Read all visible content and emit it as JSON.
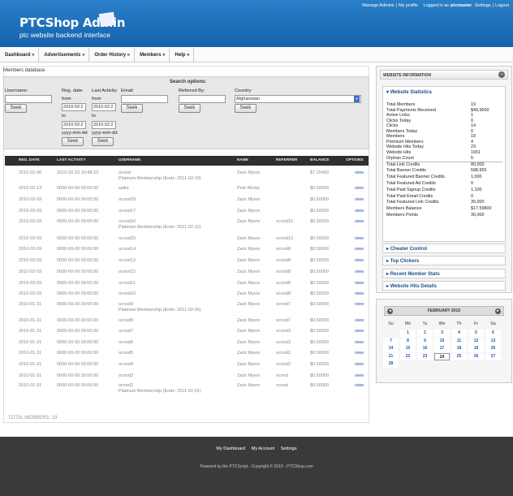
{
  "header": {
    "title": "PTCShop Admin",
    "subtitle": "ptc website backend interface",
    "links": [
      "Manage Admins",
      "|",
      "My profile",
      "Logged in as",
      "ptcmaster",
      "Settings",
      "|",
      "Logout"
    ]
  },
  "nav": [
    "Dashboard »",
    "Advertisements »",
    "Order History »",
    "Members »",
    "Help »"
  ],
  "page_title": "Members database",
  "search": {
    "title": "Search options:",
    "username_label": "Username:",
    "reg_label": "Reg. date:",
    "activity_label": "Last Activity:",
    "email_label": "Email:",
    "ref_label": "Referred By:",
    "country_label": "Country:",
    "from": "from",
    "to": "to",
    "date1": "2010:02:2",
    "date2": "2010:02:2",
    "fmt": "yyyy-mm-dd",
    "country_value": "Afghanistan",
    "seek": "Seek"
  },
  "table": {
    "headers": [
      "REG. DATE",
      "LAST ACTIVITY",
      "USERNAME",
      "NAME",
      "REFERRER",
      "BALANCE",
      "OPTIONS"
    ],
    "rows": [
      {
        "reg": "2010-02-06",
        "act": "2010-02-23 10:48:23",
        "user": "ocnod",
        "sub": "Platinum Membership (Ends: 2011-02-19)",
        "name": "Zack Myers",
        "ref": "",
        "bal": "$7.25400",
        "opt": "view"
      },
      {
        "reg": "2010-02-13",
        "act": "0000-00-00 00:00:00",
        "user": "spike",
        "sub": "",
        "name": "Pete Morby",
        "ref": "",
        "bal": "$0.50000",
        "opt": "view"
      },
      {
        "reg": "2010-02-09",
        "act": "0000-00-00 00:00:00",
        "user": "ocnod18",
        "sub": "",
        "name": "Zack Myers",
        "ref": "",
        "bal": "$0.50000",
        "opt": "view"
      },
      {
        "reg": "2010-02-09",
        "act": "0000-00-00 00:00:00",
        "user": "ocnod17",
        "sub": "",
        "name": "Zack Myers",
        "ref": "",
        "bal": "$0.50000",
        "opt": "view"
      },
      {
        "reg": "2010-02-09",
        "act": "0000-00-00 00:00:00",
        "user": "ocnod16",
        "sub": "Platinum Membership (Ends: 2011-02-12)",
        "name": "Zack Myers",
        "ref": "ocnod15",
        "bal": "$0.90000",
        "opt": "view"
      },
      {
        "reg": "2010-02-09",
        "act": "0000-00-00 00:00:00",
        "user": "ocnod15",
        "sub": "",
        "name": "Zack Myers",
        "ref": "ocnod13",
        "bal": "$0.50000",
        "opt": "view"
      },
      {
        "reg": "2010-02-09",
        "act": "0000-00-00 00:00:00",
        "user": "ocnod14",
        "sub": "",
        "name": "Zack Myers",
        "ref": "ocnod8",
        "bal": "$0.50000",
        "opt": "view"
      },
      {
        "reg": "2010-02-09",
        "act": "0000-00-00 00:00:00",
        "user": "ocnod13",
        "sub": "",
        "name": "Zack Myers",
        "ref": "ocnod8",
        "bal": "$0.50000",
        "opt": "view"
      },
      {
        "reg": "2010-02-09",
        "act": "0000-00-00 00:00:00",
        "user": "ocnod12",
        "sub": "",
        "name": "Zack Myers",
        "ref": "ocnod8",
        "bal": "$0.50000",
        "opt": "view"
      },
      {
        "reg": "2010-02-09",
        "act": "0000-00-00 00:00:00",
        "user": "ocnod11",
        "sub": "",
        "name": "Zack Myers",
        "ref": "ocnod8",
        "bal": "$0.50000",
        "opt": "view"
      },
      {
        "reg": "2010-02-09",
        "act": "0000-00-00 00:00:00",
        "user": "ocnod10",
        "sub": "",
        "name": "Zack Myers",
        "ref": "ocnod8",
        "bal": "$0.50000",
        "opt": "view"
      },
      {
        "reg": "2010-01-31",
        "act": "0000-00-00 00:00:00",
        "user": "ocnod9",
        "sub": "Platinum Membership (Ends: 2011-02-06)",
        "name": "Zack Myers",
        "ref": "ocnod7",
        "bal": "$0.50000",
        "opt": "view"
      },
      {
        "reg": "2010-01-31",
        "act": "0000-00-00 00:00:00",
        "user": "ocnod8",
        "sub": "",
        "name": "Zack Myers",
        "ref": "ocnod7",
        "bal": "$0.50000",
        "opt": "view"
      },
      {
        "reg": "2010-01-31",
        "act": "0000-00-00 00:00:00",
        "user": "ocnod7",
        "sub": "",
        "name": "Zack Myers",
        "ref": "ocnod3",
        "bal": "$0.50000",
        "opt": "view"
      },
      {
        "reg": "2010-01-31",
        "act": "0000-00-00 00:00:00",
        "user": "ocnod6",
        "sub": "",
        "name": "Zack Myers",
        "ref": "ocnod3",
        "bal": "$0.50000",
        "opt": "view"
      },
      {
        "reg": "2010-01-31",
        "act": "0000-00-00 00:00:00",
        "user": "ocnod5",
        "sub": "",
        "name": "Zack Myers",
        "ref": "ocnod2",
        "bal": "$0.50000",
        "opt": "view"
      },
      {
        "reg": "2010-01-31",
        "act": "0000-00-00 00:00:00",
        "user": "ocnod4",
        "sub": "",
        "name": "Zack Myers",
        "ref": "ocnod2",
        "bal": "$0.50000",
        "opt": "view"
      },
      {
        "reg": "2010-01-31",
        "act": "0000-00-00 00:00:00",
        "user": "ocnod3",
        "sub": "",
        "name": "Zack Myers",
        "ref": "ocnod",
        "bal": "$0.50000",
        "opt": "view"
      },
      {
        "reg": "2010-01-31",
        "act": "0000-00-00 00:00:00",
        "user": "ocnod2",
        "sub": "Platinum Membership (Ends: 2011-02-01)",
        "name": "Zack Myers",
        "ref": "ocnod",
        "bal": "$0.50000",
        "opt": "view"
      }
    ]
  },
  "total": "TOTAL MEMBERS: 19",
  "sidebar": {
    "head": "WEBSITE INFORMATION",
    "stats_title": "Website Statistics",
    "stats": [
      [
        "Total Members",
        "19"
      ],
      [
        "Total Payments Received",
        "$49,9500"
      ],
      [
        "Active Links",
        "1"
      ],
      [
        "Clicks Today",
        "0"
      ],
      [
        "Clicks",
        "14"
      ],
      [
        "Members Today",
        "0"
      ],
      [
        "Members",
        "19"
      ],
      [
        "Premium Members",
        "4"
      ],
      [
        "Website Hits Today",
        "23"
      ],
      [
        "Website Hits",
        "1651"
      ],
      [
        "Orphan Count",
        "5"
      ]
    ],
    "stats2": [
      [
        "Total Link Credits",
        "80,000"
      ],
      [
        "Total Banner Credits",
        "598,955"
      ],
      [
        "Total Featured Banner Credits",
        "1,000"
      ],
      [
        "Total Featured Ad Credits",
        "0"
      ],
      [
        "Total Paid Signup Credits",
        "1,100"
      ],
      [
        "Total Paid Email Credits",
        "0"
      ],
      [
        "Total Featured Link Credits",
        "30,000"
      ],
      [
        "Members Balance",
        "$17.59800"
      ],
      [
        "Members Points",
        "30,000"
      ]
    ],
    "panels": [
      "Cheater Control",
      "Top Clickers",
      "Recent Member Stats",
      "Website Hits Details"
    ]
  },
  "calendar": {
    "month": "FEBRUARY 2010",
    "days": [
      "Su",
      "Mo",
      "Tu",
      "We",
      "Th",
      "Fr",
      "Sa"
    ],
    "weeks": [
      [
        "",
        "1",
        "2",
        "3",
        "4",
        "5",
        "6"
      ],
      [
        "7",
        "8",
        "9",
        "10",
        "11",
        "12",
        "13"
      ],
      [
        "14",
        "15",
        "16",
        "17",
        "18",
        "19",
        "20"
      ],
      [
        "21",
        "22",
        "23",
        "24",
        "25",
        "26",
        "27"
      ],
      [
        "28",
        "",
        "",
        "",
        "",
        "",
        ""
      ]
    ]
  },
  "footer": {
    "links": [
      "My Dashboard",
      "My Account",
      "Settings"
    ],
    "copy": "Powered by the PTCScript - Copyright © 2010 - PTCShop.com"
  }
}
